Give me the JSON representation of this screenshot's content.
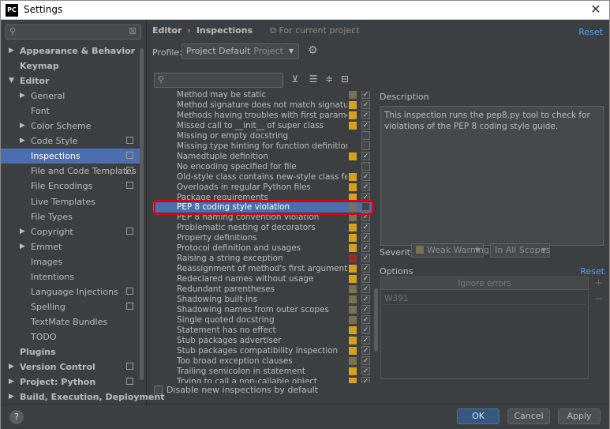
{
  "window": {
    "title": "Settings",
    "app_icon": "PC",
    "close_glyph": "✕"
  },
  "sidebar": {
    "search_placeholder": "",
    "items": [
      {
        "label": "Appearance & Behavior",
        "arrow": "▶",
        "bold": true,
        "level": 0
      },
      {
        "label": "Keymap",
        "arrow": "",
        "bold": true,
        "level": 0
      },
      {
        "label": "Editor",
        "arrow": "▼",
        "bold": true,
        "level": 0
      },
      {
        "label": "General",
        "arrow": "▶",
        "level": 1
      },
      {
        "label": "Font",
        "arrow": "",
        "level": 1
      },
      {
        "label": "Color Scheme",
        "arrow": "▶",
        "level": 1
      },
      {
        "label": "Code Style",
        "arrow": "▶",
        "level": 1,
        "copy": true
      },
      {
        "label": "Inspections",
        "arrow": "",
        "level": 1,
        "copy": true,
        "selected": true
      },
      {
        "label": "File and Code Templates",
        "arrow": "",
        "level": 1,
        "copy": true
      },
      {
        "label": "File Encodings",
        "arrow": "",
        "level": 1,
        "copy": true
      },
      {
        "label": "Live Templates",
        "arrow": "",
        "level": 1
      },
      {
        "label": "File Types",
        "arrow": "",
        "level": 1
      },
      {
        "label": "Copyright",
        "arrow": "▶",
        "level": 1,
        "copy": true
      },
      {
        "label": "Emmet",
        "arrow": "▶",
        "level": 1
      },
      {
        "label": "Images",
        "arrow": "",
        "level": 1
      },
      {
        "label": "Intentions",
        "arrow": "",
        "level": 1
      },
      {
        "label": "Language Injections",
        "arrow": "",
        "level": 1,
        "copy": true
      },
      {
        "label": "Spelling",
        "arrow": "",
        "level": 1,
        "copy": true
      },
      {
        "label": "TextMate Bundles",
        "arrow": "",
        "level": 1
      },
      {
        "label": "TODO",
        "arrow": "",
        "level": 1
      },
      {
        "label": "Plugins",
        "arrow": "",
        "bold": true,
        "level": 0
      },
      {
        "label": "Version Control",
        "arrow": "▶",
        "bold": true,
        "level": 0,
        "copy": true
      },
      {
        "label": "Project: Python",
        "arrow": "▶",
        "bold": true,
        "level": 0,
        "copy": true
      },
      {
        "label": "Build, Execution, Deployment",
        "arrow": "▶",
        "bold": true,
        "level": 0
      }
    ]
  },
  "breadcrumb": {
    "root": "Editor",
    "sep": "›",
    "current": "Inspections",
    "scope_note": "For current project"
  },
  "reset_label": "Reset",
  "profile": {
    "label": "Profile:",
    "value": "Project Default",
    "sub": "Project"
  },
  "inspections": [
    {
      "name": "Method may be static",
      "sev": "weak",
      "checked": true
    },
    {
      "name": "Method signature does not match signature of overr",
      "sev": "warn",
      "checked": true
    },
    {
      "name": "Methods having troubles with first parameter",
      "sev": "warn",
      "checked": true
    },
    {
      "name": "Missed call to __init__ of super class",
      "sev": "warn",
      "checked": true
    },
    {
      "name": "Missing or empty docstring",
      "sev": "none",
      "checked": false
    },
    {
      "name": "Missing type hinting for function definition",
      "sev": "none",
      "checked": false
    },
    {
      "name": "Namedtuple definition",
      "sev": "warn",
      "checked": true
    },
    {
      "name": "No encoding specified for file",
      "sev": "none",
      "checked": false
    },
    {
      "name": "Old-style class contains new-style class features",
      "sev": "warn",
      "checked": true
    },
    {
      "name": "Overloads in regular Python files",
      "sev": "warn",
      "checked": true
    },
    {
      "name": "Package requirements",
      "sev": "warn",
      "checked": true
    },
    {
      "name": "PEP 8 coding style violation",
      "sev": "weak",
      "checked": false,
      "selected": true
    },
    {
      "name": "PEP 8 naming convention violation",
      "sev": "weak",
      "checked": true
    },
    {
      "name": "Problematic nesting of decorators",
      "sev": "warn",
      "checked": true
    },
    {
      "name": "Property definitions",
      "sev": "warn",
      "checked": true
    },
    {
      "name": "Protocol definition and usages",
      "sev": "warn",
      "checked": true
    },
    {
      "name": "Raising a string exception",
      "sev": "err",
      "checked": true
    },
    {
      "name": "Reassignment of method's first argument",
      "sev": "warn",
      "checked": true
    },
    {
      "name": "Redeclared names without usage",
      "sev": "warn",
      "checked": true
    },
    {
      "name": "Redundant parentheses",
      "sev": "weak",
      "checked": true
    },
    {
      "name": "Shadowing built-ins",
      "sev": "weak",
      "checked": true
    },
    {
      "name": "Shadowing names from outer scopes",
      "sev": "weak",
      "checked": true
    },
    {
      "name": "Single quoted docstring",
      "sev": "weak",
      "checked": true
    },
    {
      "name": "Statement has no effect",
      "sev": "warn",
      "checked": true
    },
    {
      "name": "Stub packages advertiser",
      "sev": "warn",
      "checked": true
    },
    {
      "name": "Stub packages compatibility inspection",
      "sev": "warn",
      "checked": true
    },
    {
      "name": "Too broad exception clauses",
      "sev": "weak",
      "checked": true
    },
    {
      "name": "Trailing semicolon in statement",
      "sev": "warn",
      "checked": true
    },
    {
      "name": "Trying to call a non-callable object",
      "sev": "warn",
      "checked": true
    }
  ],
  "disable_new_label": "Disable new inspections by default",
  "description": {
    "label": "Description",
    "text": "This inspection runs the pep8.py tool to check for violations of the PEP 8 coding style guide."
  },
  "severity": {
    "label": "Severity:",
    "value": "Weak Warning",
    "scope": "In All Scopes"
  },
  "options": {
    "label": "Options",
    "reset": "Reset",
    "header": "Ignore errors",
    "value": "W391",
    "add": "+",
    "remove": "−"
  },
  "buttons": {
    "help": "?",
    "ok": "OK",
    "cancel": "Cancel",
    "apply": "Apply"
  },
  "colors": {
    "warn": "#d6a21d",
    "weak": "#7a7153",
    "err": "#9e2927",
    "selection": "#4b6eaf",
    "link": "#589df6"
  }
}
